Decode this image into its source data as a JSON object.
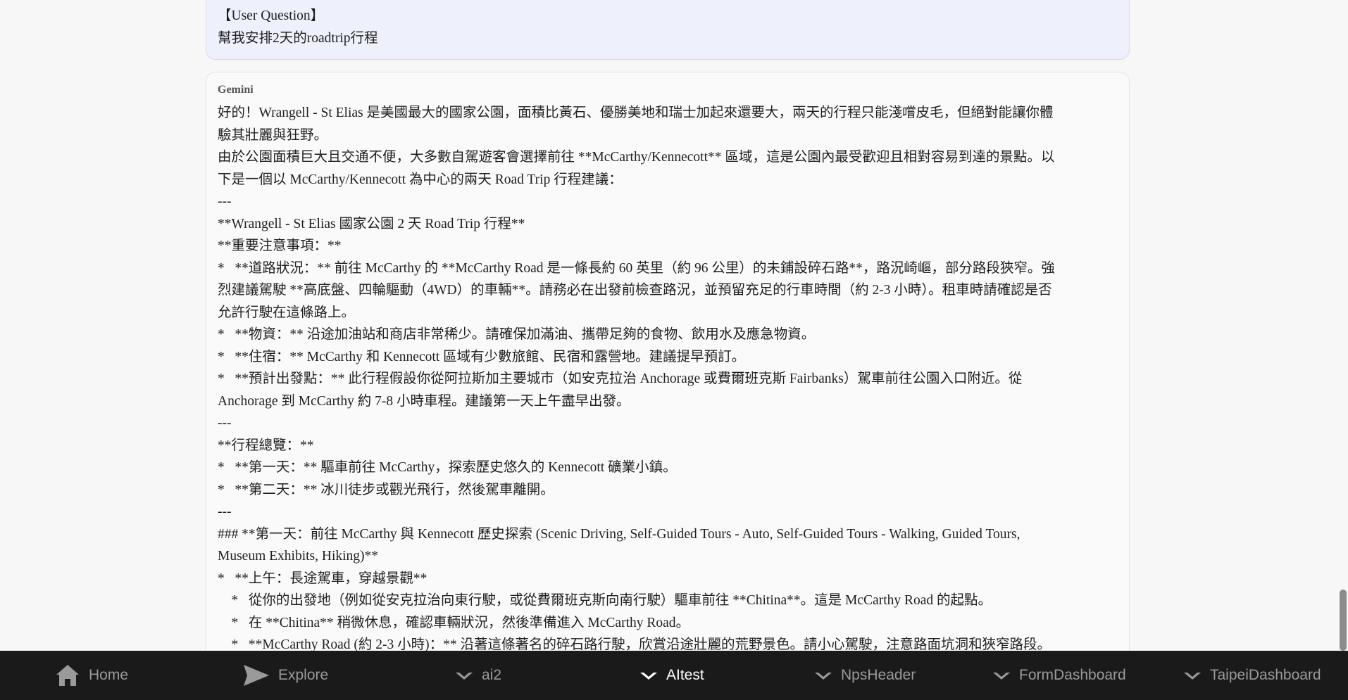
{
  "conversation": {
    "user": {
      "lines": [
        "【User Question】",
        "幫我安排2天的roadtrip行程"
      ]
    },
    "gemini": {
      "speaker": "Gemini",
      "lines": [
        "好的！Wrangell - St Elias 是美國最大的國家公園，面積比黃石、優勝美地和瑞士加起來還要大，兩天的行程只能淺嚐皮毛，但絕對能讓你體",
        "驗其壯麗與狂野。",
        "由於公園面積巨大且交通不便，大多數自駕遊客會選擇前往 **McCarthy/Kennecott** 區域，這是公園內最受歡迎且相對容易到達的景點。以",
        "下是一個以 McCarthy/Kennecott 為中心的兩天 Road Trip 行程建議：",
        "---",
        "**Wrangell - St Elias 國家公園 2 天 Road Trip 行程**",
        "**重要注意事項：**",
        "*   **道路狀況：** 前往 McCarthy 的 **McCarthy Road 是一條長約 60 英里（約 96 公里）的未鋪設碎石路**，路況崎嶇，部分路段狹窄。強",
        "烈建議駕駛 **高底盤、四輪驅動（4WD）的車輛**。請務必在出發前檢查路況，並預留充足的行車時間（約 2-3 小時）。租車時請確認是否",
        "允許行駛在這條路上。",
        "*   **物資：** 沿途加油站和商店非常稀少。請確保加滿油、攜帶足夠的食物、飲用水及應急物資。",
        "*   **住宿：** McCarthy 和 Kennecott 區域有少數旅館、民宿和露營地。建議提早預訂。",
        "*   **預計出發點：** 此行程假設你從阿拉斯加主要城市（如安克拉治 Anchorage 或費爾班克斯 Fairbanks）駕車前往公園入口附近。從",
        "Anchorage 到 McCarthy 約 7-8 小時車程。建議第一天上午盡早出發。",
        "---",
        "**行程總覽：**",
        "*   **第一天：** 驅車前往 McCarthy，探索歷史悠久的 Kennecott 礦業小鎮。",
        "*   **第二天：** 冰川徒步或觀光飛行，然後駕車離開。",
        "---",
        "### **第一天：前往 McCarthy 與 Kennecott 歷史探索 (Scenic Driving, Self-Guided Tours - Auto, Self-Guided Tours - Walking, Guided Tours,",
        "Museum Exhibits, Hiking)**",
        "*   **上午：長途駕車，穿越景觀**",
        "    *   從你的出發地（例如從安克拉治向東行駛，或從費爾班克斯向南行駛）驅車前往 **Chitina**。這是 McCarthy Road 的起點。",
        "    *   在 **Chitina** 稍微休息，確認車輛狀況，然後準備進入 McCarthy Road。",
        "    *   **McCarthy Road (約 2-3 小時)：** 沿著這條著名的碎石路行駛，欣賞沿途壯麗的荒野景色。請小心駕駛，注意路面坑洞和狹窄路段。"
      ]
    }
  },
  "navbar": {
    "items": [
      {
        "label": "Home",
        "icon": "home-icon"
      },
      {
        "label": "Explore",
        "icon": "send-icon"
      },
      {
        "label": "ai2",
        "icon": "chevron-down-icon"
      },
      {
        "label": "AItest",
        "icon": "chevron-down-icon",
        "active": true
      },
      {
        "label": "NpsHeader",
        "icon": "chevron-down-icon"
      },
      {
        "label": "FormDashboard",
        "icon": "chevron-down-icon"
      },
      {
        "label": "TaipeiDashboard",
        "icon": "chevron-down-icon"
      }
    ]
  },
  "colors": {
    "navbar_bg": "#1a1a1a",
    "nav_text": "#9a9a9a",
    "nav_active": "#ffffff",
    "user_bubble": "#eef0fb"
  }
}
